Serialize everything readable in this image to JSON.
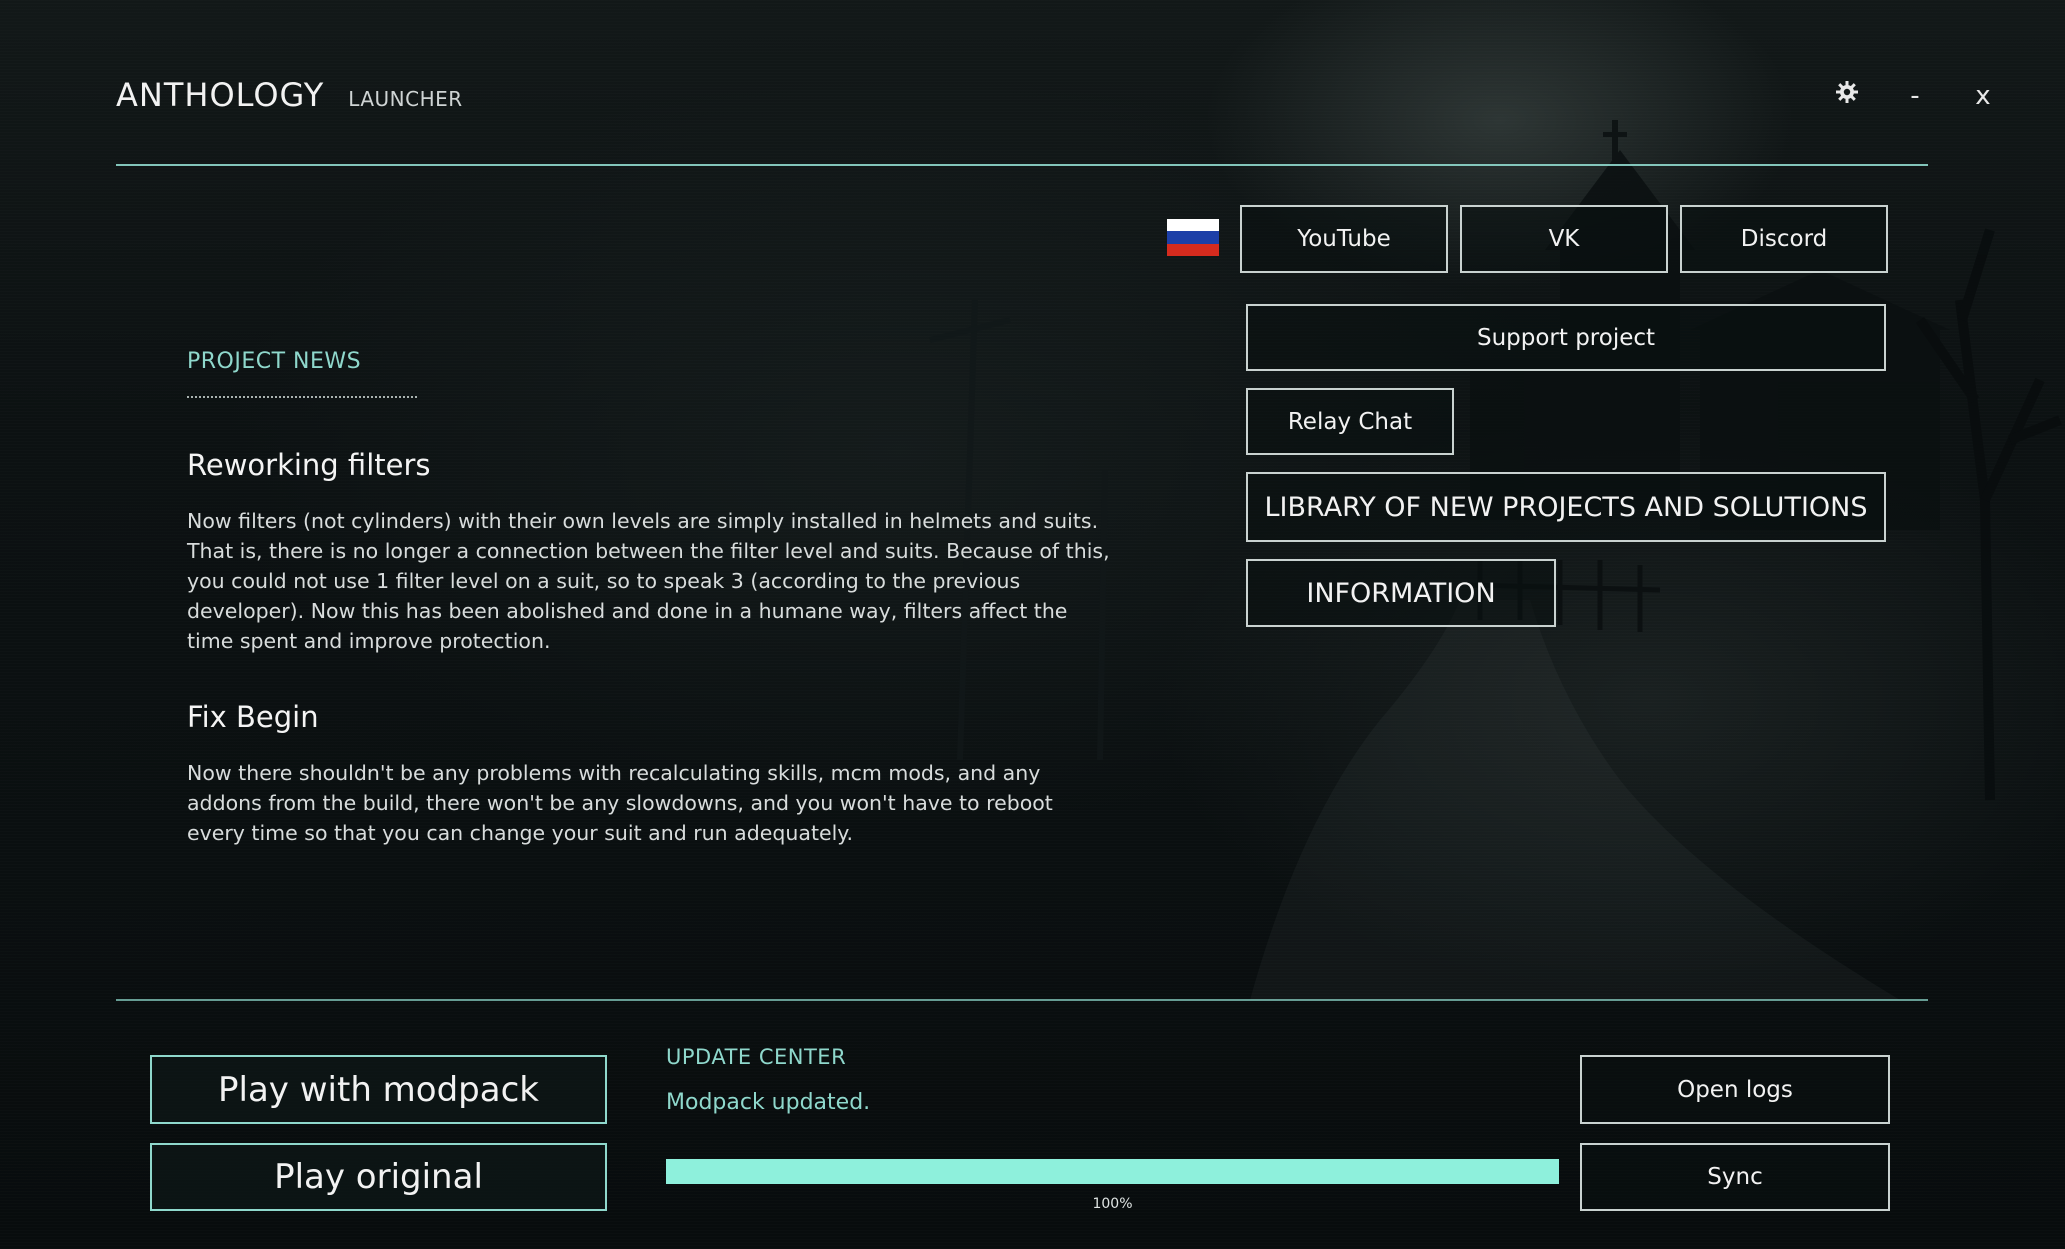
{
  "header": {
    "title": "ANTHOLOGY",
    "subtitle": "LAUNCHER",
    "settings_icon": "gear-icon",
    "minimize_label": "-",
    "close_label": "x"
  },
  "language_flag": {
    "icon": "russia-flag-icon",
    "colors": [
      "#ffffff",
      "#1c3fa8",
      "#d52b1e"
    ]
  },
  "social": {
    "youtube": "YouTube",
    "vk": "VK",
    "discord": "Discord"
  },
  "links": {
    "support": "Support project",
    "relay_chat": "Relay Chat",
    "library": "LIBRARY OF NEW PROJECTS AND SOLUTIONS",
    "information": "INFORMATION"
  },
  "news": {
    "heading": "PROJECT NEWS",
    "articles": [
      {
        "title": "Reworking filters",
        "body": "Now filters (not cylinders) with their own levels are simply installed in helmets and suits. That is, there is no longer a connection between the filter level and suits. Because of this, you could not use 1 filter level on a suit, so to speak 3 (according to the previous developer). Now this has been abolished and done in a humane way, filters affect the time spent and improve protection."
      },
      {
        "title": "Fix Begin",
        "body": "Now there shouldn't be any problems with recalculating skills, mcm mods, and any addons from the build, there won't be any slowdowns, and you won't have to reboot every time so that you can change your suit and run adequately."
      }
    ]
  },
  "play": {
    "modpack": "Play with modpack",
    "original": "Play original"
  },
  "update_center": {
    "title": "UPDATE CENTER",
    "status": "Modpack updated.",
    "progress": 1.0,
    "progress_label": "100%"
  },
  "actions": {
    "open_logs": "Open logs",
    "sync": "Sync"
  },
  "colors": {
    "accent": "#8fd8cc",
    "progress": "#8ef0dc",
    "background": "#0c1112"
  }
}
